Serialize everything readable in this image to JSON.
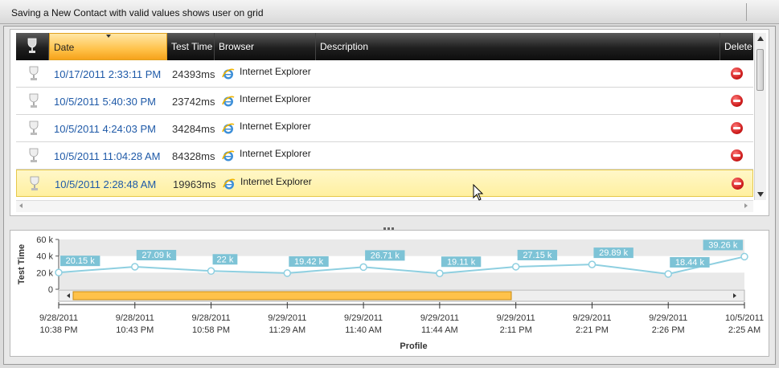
{
  "window": {
    "title": "Saving a New Contact with valid values shows user on grid"
  },
  "grid": {
    "headers": {
      "date": "Date",
      "test_time": "Test Time",
      "browser": "Browser",
      "description": "Description",
      "delete": "Delete"
    },
    "rows": [
      {
        "date": "10/17/2011 2:33:11 PM",
        "test_time": "24393ms",
        "browser": "Internet Explorer",
        "description": "",
        "selected": false
      },
      {
        "date": "10/5/2011 5:40:30 PM",
        "test_time": "23742ms",
        "browser": "Internet Explorer",
        "description": "",
        "selected": false
      },
      {
        "date": "10/5/2011 4:24:03 PM",
        "test_time": "34284ms",
        "browser": "Internet Explorer",
        "description": "",
        "selected": false
      },
      {
        "date": "10/5/2011 11:04:28 AM",
        "test_time": "84328ms",
        "browser": "Internet Explorer",
        "description": "",
        "selected": false
      },
      {
        "date": "10/5/2011 2:28:48 AM",
        "test_time": "19963ms",
        "browser": "Internet Explorer",
        "description": "",
        "selected": true
      }
    ]
  },
  "chart_data": {
    "type": "line",
    "ylabel": "Test Time",
    "xlabel": "Profile",
    "ylim": [
      0,
      60000
    ],
    "y_ticks": [
      "0",
      "20 k",
      "40 k",
      "60 k"
    ],
    "y_tick_values": [
      0,
      20000,
      40000,
      60000
    ],
    "x": [
      [
        "9/28/2011",
        "10:38 PM"
      ],
      [
        "9/28/2011",
        "10:43 PM"
      ],
      [
        "9/28/2011",
        "10:58 PM"
      ],
      [
        "9/29/2011",
        "11:29 AM"
      ],
      [
        "9/29/2011",
        "11:40 AM"
      ],
      [
        "9/29/2011",
        "11:44 AM"
      ],
      [
        "9/29/2011",
        "2:11 PM"
      ],
      [
        "9/29/2011",
        "2:21 PM"
      ],
      [
        "9/29/2011",
        "2:26 PM"
      ],
      [
        "10/5/2011",
        "2:25 AM"
      ]
    ],
    "values": [
      20150,
      27090,
      22000,
      19420,
      26710,
      19110,
      27150,
      29890,
      18440,
      39260
    ],
    "data_labels": [
      "20.15 k",
      "27.09 k",
      "22 k",
      "19.42 k",
      "26.71 k",
      "19.11 k",
      "27.15 k",
      "29.89 k",
      "18.44 k",
      "39.26 k"
    ],
    "grid": true,
    "colors": {
      "line": "#8ecfe0",
      "label_bg": "#7dc3d6",
      "band": "#e9e9e9",
      "scroll_thumb": "#ffc24a"
    }
  }
}
